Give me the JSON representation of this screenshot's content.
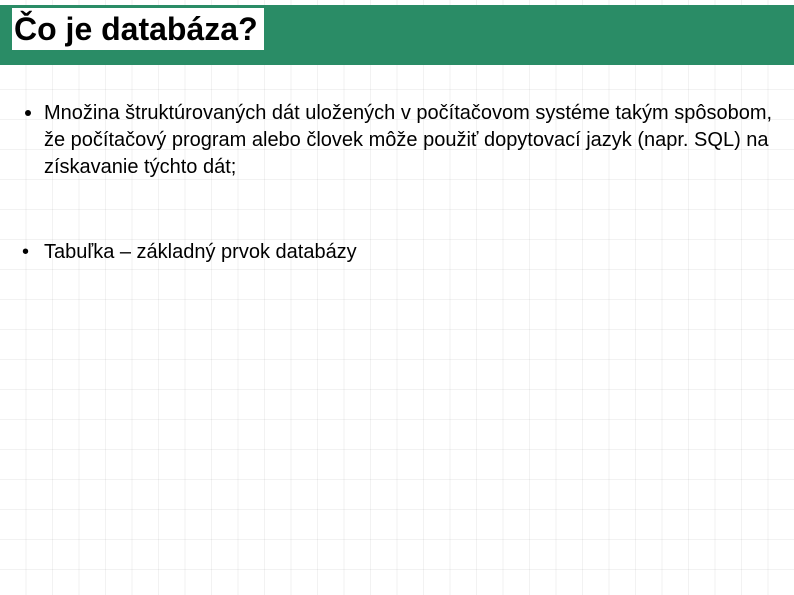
{
  "slide": {
    "title": "Čo je databáza?"
  },
  "bullets": {
    "first": "Množina štruktúrovaných dát uložených v počítačovom systéme takým spôsobom, že počítačový program alebo človek môže použiť dopytovací jazyk (napr. SQL) na získavanie týchto dát;",
    "second": "Tabuľka – základný prvok databázy"
  }
}
